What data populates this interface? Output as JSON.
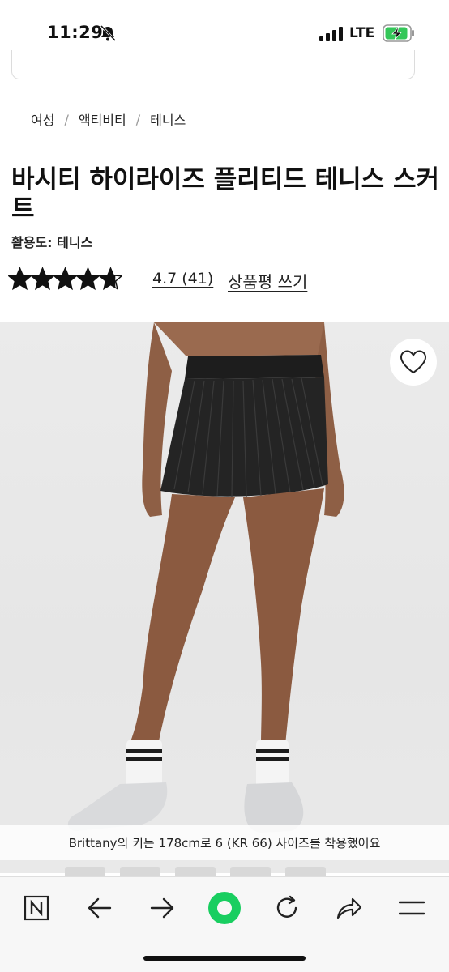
{
  "status_bar": {
    "time": "11:29",
    "network": "LTE",
    "icons": [
      "bell-slash-icon",
      "signal-icon",
      "battery-charging-icon"
    ]
  },
  "breadcrumb": [
    "여성",
    "액티비티",
    "테니스"
  ],
  "breadcrumb_separator": "/",
  "product": {
    "title": "바시티 하이라이즈 플리티드 테니스 스커트",
    "activity": "활용도: 테니스",
    "rating": "4.7",
    "review_count": "(41)",
    "rating_stars": 4.7,
    "write_review": "상품평 쓰기"
  },
  "image": {
    "caption": "Brittany의 키는 178cm로 6 (KR 66) 사이즈를 착용했어요",
    "wishlist_icon": "heart-icon"
  },
  "toolbar": {
    "items": [
      "naver-n-icon",
      "back-arrow-icon",
      "forward-arrow-icon",
      "green-circle-home-icon",
      "reload-icon",
      "share-icon",
      "menu-icon"
    ]
  },
  "colors": {
    "text": "#111111",
    "accent_green": "#19ce60",
    "image_bg": "#e8e8e8"
  }
}
